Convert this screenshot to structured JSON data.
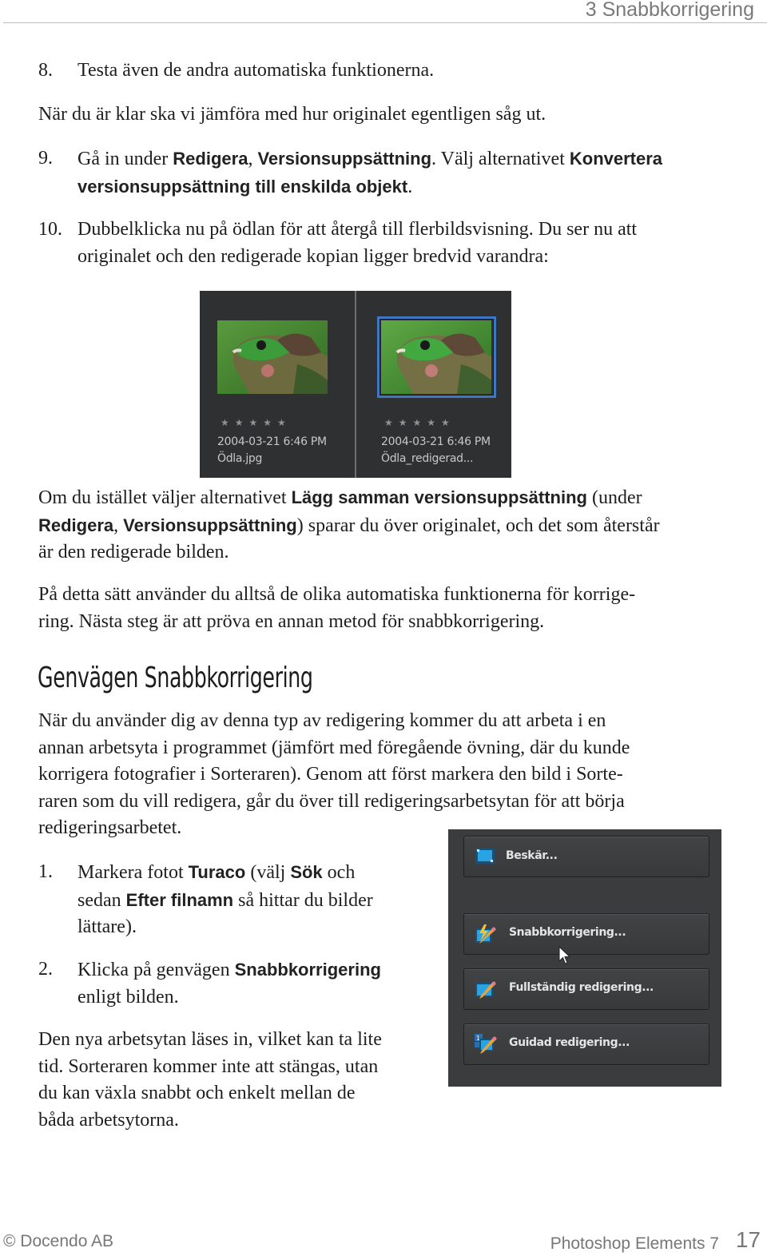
{
  "header": {
    "running_head": "3 Snabbkorrigering"
  },
  "steps_top": [
    {
      "num": "8.",
      "text": "Testa även de andra automatiska funktionerna."
    }
  ],
  "para_compare": "När du är klar ska vi jämföra med hur originalet egentligen såg ut.",
  "step9": {
    "num": "9.",
    "t1": "Gå in under ",
    "b1": "Redigera",
    "t2": ", ",
    "b2": "Versionsuppsättning",
    "t3": ". Välj alternativet ",
    "b3": "Konvertera",
    "b4": "versionsuppsättning till enskilda objekt",
    "t4": "."
  },
  "step10": {
    "num": "10.",
    "line1": "Dubbelklicka nu på ödlan för att återgå till flerbildsvisning. Du ser nu att",
    "line2": "originalet och den redigerade kopian ligger bredvid varandra:"
  },
  "thumbnails": [
    {
      "rating": "★★★★★",
      "stars_filled": 0,
      "date": "2004-03-21 6:46 PM",
      "filename": "Ödla.jpg",
      "selected": false
    },
    {
      "rating": "★★★★★",
      "stars_filled": 0,
      "date": "2004-03-21 6:46 PM",
      "filename": "Ödla_redigerad...",
      "selected": true
    }
  ],
  "para_merge": {
    "t1": "Om du istället väljer alternativet ",
    "b1": "Lägg samman versionsuppsättning",
    "t2": " (under",
    "b2": "Redigera",
    "t3": ", ",
    "b3": "Versionsuppsättning",
    "t4": ") sparar du över originalet, och det som återstår",
    "t5": "är den redigerade bilden."
  },
  "para_summary": {
    "line1": "På detta sätt använder du alltså de olika automatiska funktionerna för korrige-",
    "line2": "ring. Nästa steg är att pröva en annan metod för snabbkorrigering."
  },
  "section_heading": "Genvägen Snabbkorrigering",
  "para_intro": {
    "line1": "När du använder dig av denna typ av redigering kommer du att arbeta i en",
    "line2": "annan arbetsyta i programmet (jämfört med föregående övning, där du kunde",
    "line3": "korrigera fotografier i Sorteraren). Genom att först markera den bild i Sorte-",
    "line4": "raren som du vill redigera, går du över till redigeringsarbetsytan för att börja",
    "line5": "redigeringsarbetet."
  },
  "step1": {
    "num": "1.",
    "t1": "Markera fotot ",
    "b1": "Turaco",
    "t2": " (välj ",
    "b2": "Sök",
    "t3": " och",
    "t4": "sedan ",
    "b3": "Efter filnamn",
    "t5": " så hittar du bilder",
    "t6": "lättare)."
  },
  "step2": {
    "num": "2.",
    "t1": "Klicka på genvägen ",
    "b1": "Snabbkorrigering",
    "t2": "enligt bilden."
  },
  "para_workspace": {
    "line1": "Den nya arbetsytan läses in, vilket kan ta lite",
    "line2": "tid. Sorteraren kommer inte att stängas, utan",
    "line3": "du kan växla snabbt och enkelt mellan de",
    "line4": "båda arbetsytorna."
  },
  "shortcuts": [
    {
      "label": "Beskär...",
      "icon": "crop-icon"
    },
    {
      "label": "Snabbkorrigering...",
      "icon": "quick-fix-icon",
      "hovered": true
    },
    {
      "label": "Fullständig redigering...",
      "icon": "full-edit-icon"
    },
    {
      "label": "Guidad redigering...",
      "icon": "guided-edit-icon"
    }
  ],
  "colors": {
    "selection_blue": "#3f77c2",
    "panel_dark": "#2e3032",
    "shortcut_panel": "#3b3c3e"
  },
  "footer": {
    "copyright": "© Docendo AB",
    "book_title": "Photoshop Elements 7",
    "page_number": "17"
  }
}
